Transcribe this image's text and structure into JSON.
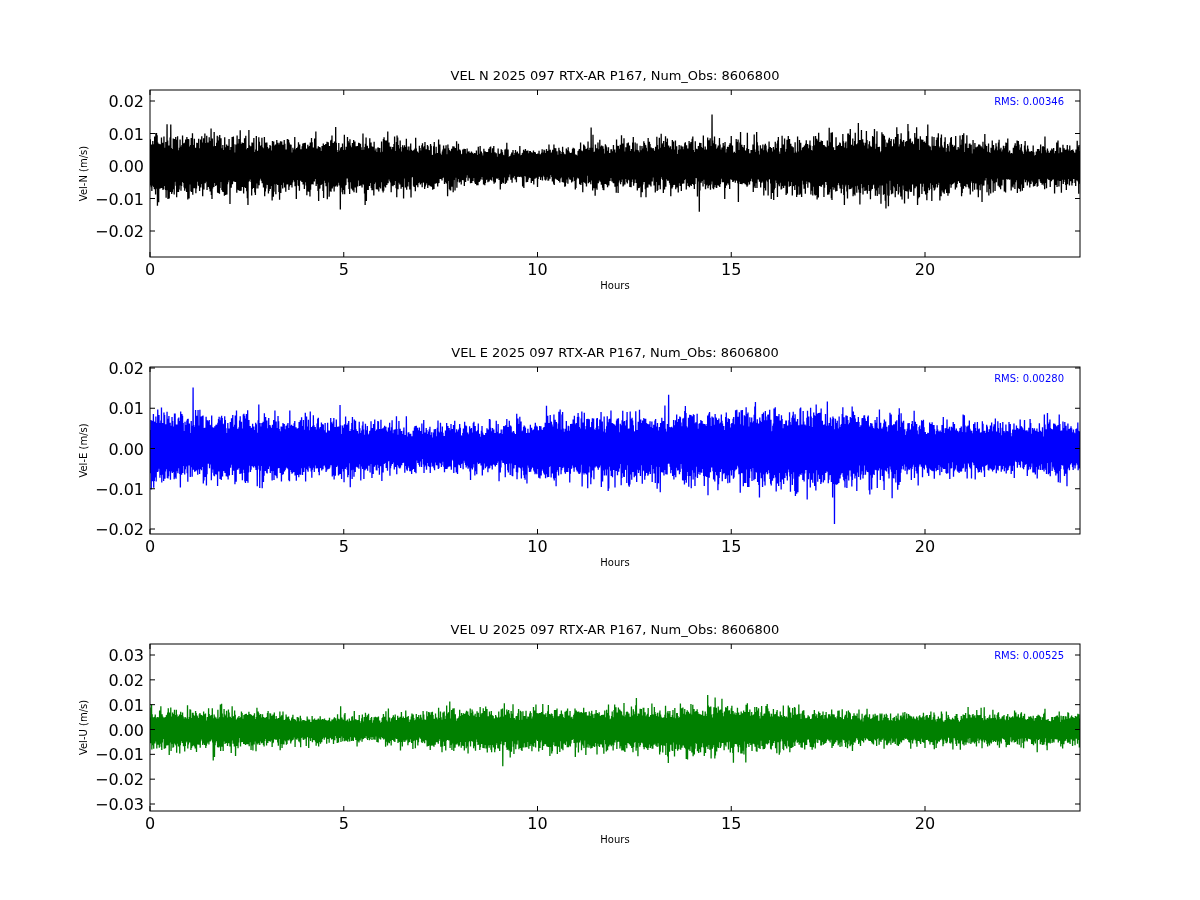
{
  "panels": [
    {
      "title": "VEL N 2025 097 RTX-AR  P167, Num_Obs: 8606800",
      "ylabel": "Vel-N (m/s)",
      "xlabel": "Hours",
      "rms": "RMS:  0.00346",
      "color": "#000000",
      "xticks": [
        "0",
        "5",
        "10",
        "15",
        "20"
      ],
      "yticks": [
        "0.02",
        "0.01",
        "0.00",
        "−0.01",
        "−0.02"
      ]
    },
    {
      "title": "VEL E 2025 097 RTX-AR  P167, Num_Obs: 8606800",
      "ylabel": "Vel-E (m/s)",
      "xlabel": "Hours",
      "rms": "RMS:  0.00280",
      "color": "#0000ff",
      "xticks": [
        "0",
        "5",
        "10",
        "15",
        "20"
      ],
      "yticks": [
        "0.02",
        "0.01",
        "0.00",
        "−0.01",
        "−0.02"
      ]
    },
    {
      "title": "VEL U 2025 097 RTX-AR  P167, Num_Obs: 8606800",
      "ylabel": "Vel-U (m/s)",
      "xlabel": "Hours",
      "rms": "RMS:  0.00525",
      "color": "#008000",
      "xticks": [
        "0",
        "5",
        "10",
        "15",
        "20"
      ],
      "yticks": [
        "0.03",
        "0.02",
        "0.01",
        "0.00",
        "−0.01",
        "−0.02",
        "−0.03"
      ]
    }
  ]
}
